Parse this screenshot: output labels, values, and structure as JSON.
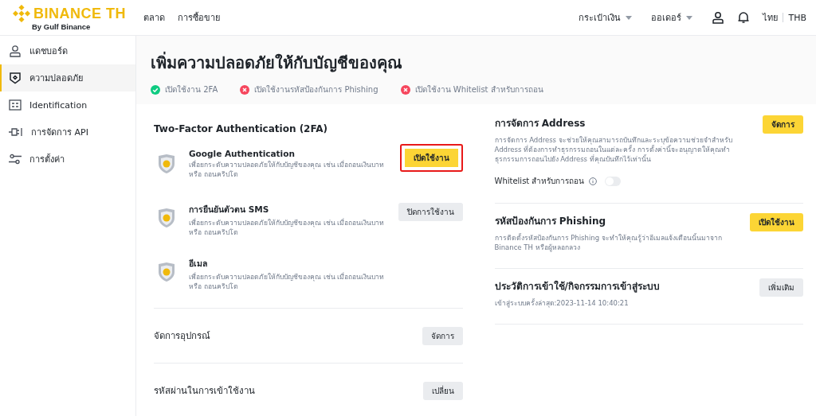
{
  "header": {
    "logo": "BINANCE TH",
    "logo_sub": "By Gulf Binance",
    "nav": [
      "ตลาด",
      "การซื้อขาย"
    ],
    "menus": [
      "กระเป๋าเงิน",
      "ออเดอร์"
    ],
    "language": "ไทย",
    "currency": "THB"
  },
  "sidebar": {
    "items": [
      {
        "label": "แดชบอร์ด",
        "selected": false
      },
      {
        "label": "ความปลอดภัย",
        "selected": true
      },
      {
        "label": "Identification",
        "selected": false
      },
      {
        "label": "การจัดการ API",
        "selected": false
      },
      {
        "label": "การตั้งค่า",
        "selected": false
      }
    ]
  },
  "banner": {
    "title": "เพิ่มความปลอดภัยให้กับบัญชีของคุณ",
    "status": [
      {
        "label": "เปิดใช้งาน 2FA",
        "done": true
      },
      {
        "label": "เปิดใช้งานรหัสป้องกันการ Phishing",
        "done": false
      },
      {
        "label": "เปิดใช้งาน Whitelist สำหรับการถอน",
        "done": false
      }
    ]
  },
  "left": {
    "heading": "Two-Factor Authentication (2FA)",
    "methods": [
      {
        "title": "Google Authentication",
        "description": "เพื่อยกระดับความปลอดภัยให้กับบัญชีของคุณ เช่น เมื่อถอนเงินบาท หรือ ถอนคริปโต",
        "button": {
          "label": "เปิดใช้งาน",
          "kind": "primary",
          "highlighted": true
        }
      },
      {
        "title": "การยืนยันตัวตน SMS",
        "description": "เพื่อยกระดับความปลอดภัยให้กับบัญชีของคุณ เช่น เมื่อถอนเงินบาท หรือ ถอนคริปโต",
        "button": {
          "label": "ปิดการใช้งาน",
          "kind": "secondary",
          "highlighted": false
        }
      },
      {
        "title": "อีเมล",
        "description": "เพื่อยกระดับความปลอดภัยให้กับบัญชีของคุณ เช่น เมื่อถอนเงินบาท หรือ ถอนคริปโต"
      }
    ],
    "rows": [
      {
        "title": "จัดการอุปกรณ์",
        "button": {
          "label": "จัดการ",
          "kind": "secondary",
          "highlighted": false
        }
      },
      {
        "title": "รหัสผ่านในการเข้าใช้งาน",
        "button": {
          "label": "เปลี่ยน",
          "kind": "secondary",
          "highlighted": false
        }
      }
    ]
  },
  "right": {
    "sections": [
      {
        "title": "การจัดการ Address",
        "description": "การจัดการ Address จะช่วยให้คุณสามารถบันทึกและระบุข้อความช่วยจำสำหรับ Address ที่ต้องการทำธุรกรรมถอนในแต่ละครั้ง การตั้งค่านี้จะอนุญาตให้คุณทำธุรกรรมการถอนไปยัง Address ที่คุณบันทึกไว้เท่านั้น",
        "toggle": {
          "label": "Whitelist สำหรับการถอน",
          "on": false
        },
        "button": {
          "label": "จัดการ",
          "kind": "primary",
          "highlighted": false
        }
      },
      {
        "title": "รหัสป้องกันการ Phishing",
        "description": "การติดตั้งรหัสป้องกันการ Phishing จะทำให้คุณรู้ว่าอีเมลแจ้งเตือนนั้นมาจาก Binance TH หรือผู้หลอกลวง",
        "button": {
          "label": "เปิดใช้งาน",
          "kind": "primary",
          "highlighted": false
        }
      },
      {
        "title": "ประวัติการเข้าใช้/กิจกรรมการเข้าสู่ระบบ",
        "description": "เข้าสู่ระบบครั้งล่าสุด:2023-11-14 10:40:21",
        "button": {
          "label": "เพิ่มเติม",
          "kind": "secondary",
          "highlighted": false
        }
      }
    ]
  }
}
